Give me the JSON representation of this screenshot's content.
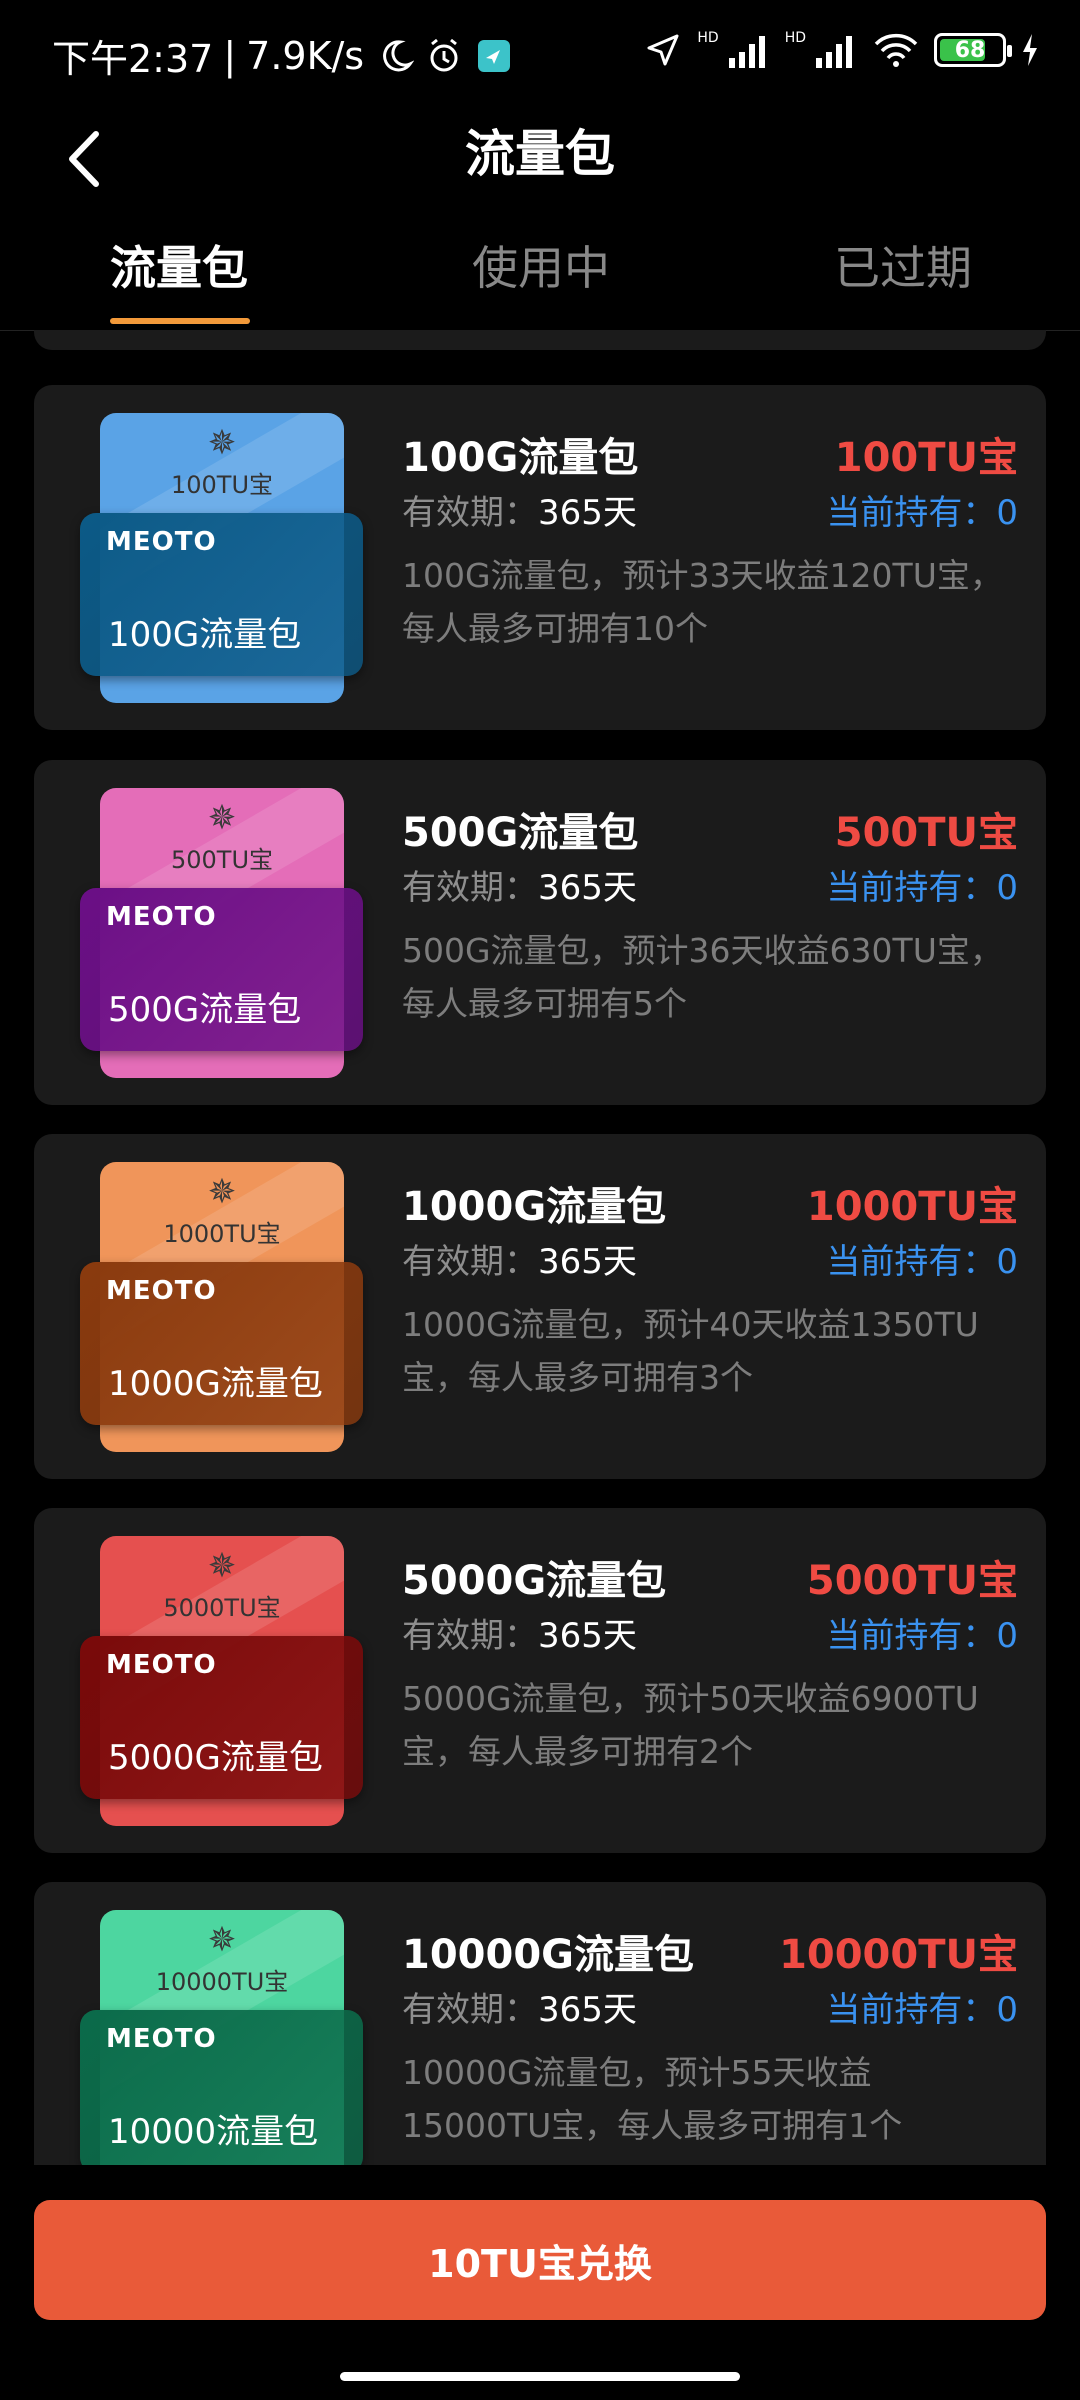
{
  "status": {
    "time": "下午2:37",
    "speed": "7.9K/s",
    "battery": "68",
    "hd1": "HD",
    "hd2": "HD"
  },
  "header": {
    "title": "流量包"
  },
  "tabs": [
    {
      "label": "流量包",
      "active": true
    },
    {
      "label": "使用中",
      "active": false
    },
    {
      "label": "已过期",
      "active": false
    }
  ],
  "packages": [
    {
      "thumb_tu": "100TU宝",
      "thumb_name": "100G流量包",
      "title": "100G流量包",
      "price": "100TU宝",
      "validity_label": "有效期：",
      "validity_value": "365天",
      "holding": "当前持有：0",
      "desc": "100G流量包，预计33天收益120TU宝，每人最多可拥有10个",
      "back_color": "#5aa3e6",
      "front_color": "#0c5a87"
    },
    {
      "thumb_tu": "500TU宝",
      "thumb_name": "500G流量包",
      "title": "500G流量包",
      "price": "500TU宝",
      "validity_label": "有效期：",
      "validity_value": "365天",
      "holding": "当前持有：0",
      "desc": "500G流量包，预计36天收益630TU宝，每人最多可拥有5个",
      "back_color": "#e46db8",
      "front_color": "#6b0f86"
    },
    {
      "thumb_tu": "1000TU宝",
      "thumb_name": "1000G流量包",
      "title": "1000G流量包",
      "price": "1000TU宝",
      "validity_label": "有效期：",
      "validity_value": "365天",
      "holding": "当前持有：0",
      "desc": "1000G流量包，预计40天收益1350TU宝，每人最多可拥有3个",
      "back_color": "#f0955a",
      "front_color": "#8a3a0e"
    },
    {
      "thumb_tu": "5000TU宝",
      "thumb_name": "5000G流量包",
      "title": "5000G流量包",
      "price": "5000TU宝",
      "validity_label": "有效期：",
      "validity_value": "365天",
      "holding": "当前持有：0",
      "desc": "5000G流量包，预计50天收益6900TU宝，每人最多可拥有2个",
      "back_color": "#e5504f",
      "front_color": "#7a0a0a"
    },
    {
      "thumb_tu": "10000TU宝",
      "thumb_name": "10000流量包",
      "title": "10000G流量包",
      "price": "10000TU宝",
      "validity_label": "有效期：",
      "validity_value": "365天",
      "holding": "当前持有：0",
      "desc": "10000G流量包，预计55天收益15000TU宝，每人最多可拥有1个",
      "back_color": "#4dd6a0",
      "front_color": "#0b6b4a"
    }
  ],
  "thumb_logo": "MEOTO",
  "redeem_label": "10TU宝兑换"
}
